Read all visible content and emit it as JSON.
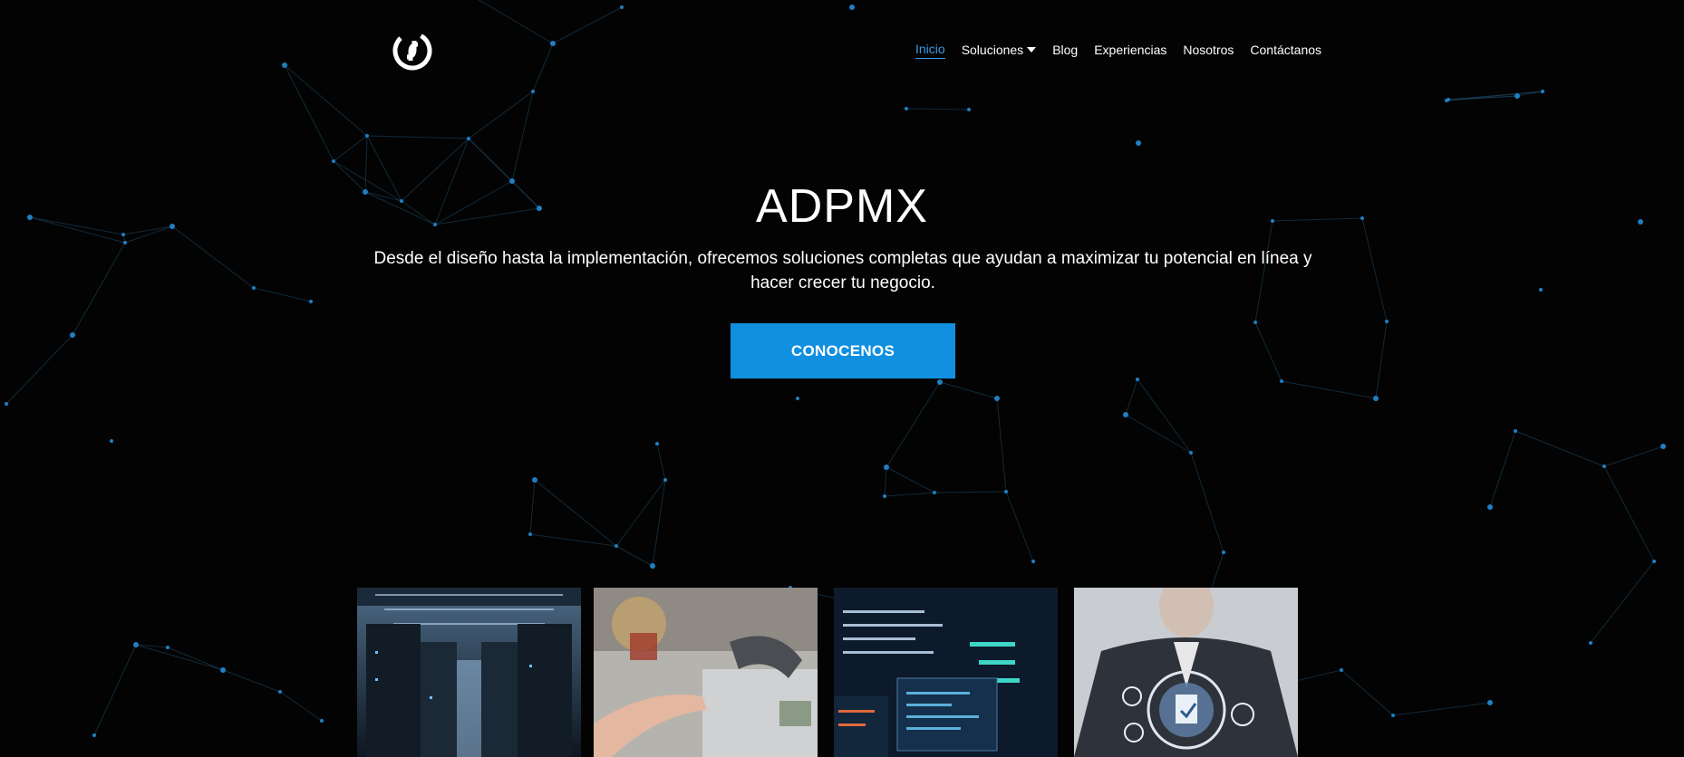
{
  "brand": {
    "logo_icon": "adpmx-logo-icon"
  },
  "nav": {
    "items": [
      {
        "label": "Inicio",
        "active": true
      },
      {
        "label": "Soluciones",
        "dropdown": true
      },
      {
        "label": "Blog"
      },
      {
        "label": "Experiencias"
      },
      {
        "label": "Nosotros"
      },
      {
        "label": "Contáctanos"
      }
    ]
  },
  "hero": {
    "title": "ADPMX",
    "subtitle": "Desde el diseño hasta la implementación, ofrecemos soluciones completas que ayudan a maximizar tu potencial en línea y hacer crecer tu negocio.",
    "cta_label": "CONOCENOS"
  },
  "cards": [
    {
      "image": "server-room-image"
    },
    {
      "image": "office-telephone-image"
    },
    {
      "image": "code-screens-image"
    },
    {
      "image": "business-management-icons-image"
    }
  ],
  "colors": {
    "accent": "#118fe0",
    "active_link": "#3b9ae6",
    "background": "#030303"
  }
}
